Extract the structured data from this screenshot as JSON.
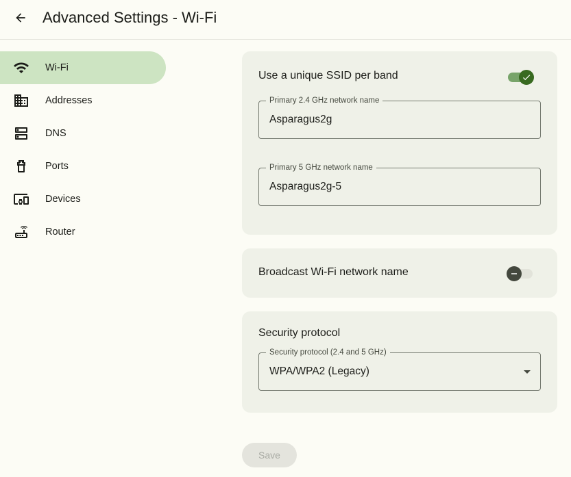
{
  "header": {
    "back_icon": "arrow-back-icon",
    "title": "Advanced Settings - Wi-Fi"
  },
  "sidebar": {
    "items": [
      {
        "label": "Wi-Fi",
        "icon": "wifi-icon",
        "active": true
      },
      {
        "label": "Addresses",
        "icon": "building-icon",
        "active": false
      },
      {
        "label": "DNS",
        "icon": "dns-icon",
        "active": false
      },
      {
        "label": "Ports",
        "icon": "ethernet-port-icon",
        "active": false
      },
      {
        "label": "Devices",
        "icon": "devices-icon",
        "active": false
      },
      {
        "label": "Router",
        "icon": "router-icon",
        "active": false
      }
    ]
  },
  "ssid_card": {
    "title": "Use a unique SSID per band",
    "toggle_on": true,
    "primary_24": {
      "label": "Primary 2.4 GHz network name",
      "value": "Asparagus2g"
    },
    "primary_5": {
      "label": "Primary 5 GHz network name",
      "value": "Asparagus2g-5"
    }
  },
  "broadcast_card": {
    "title": "Broadcast Wi-Fi network name",
    "toggle_on": false
  },
  "security_card": {
    "title": "Security protocol",
    "field_label": "Security protocol (2.4 and 5 GHz)",
    "selected": "WPA/WPA2 (Legacy)"
  },
  "save_label": "Save",
  "colors": {
    "background": "#fcfcf5",
    "active_nav": "#cde4c2",
    "card": "#eff1e8",
    "toggle_on_track": "#78a46a",
    "toggle_on_knob": "#386a20",
    "toggle_off_knob": "#44483e"
  }
}
